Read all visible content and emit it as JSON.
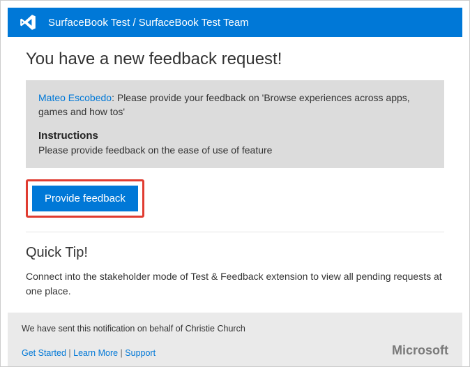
{
  "header": {
    "breadcrumb": "SurfaceBook Test / SurfaceBook Test Team"
  },
  "title": "You have a new feedback request!",
  "request": {
    "requester_name": "Mateo Escobedo",
    "message_separator": ": ",
    "message": "Please provide your feedback on 'Browse experiences across  apps, games and how tos'",
    "instructions_heading": "Instructions",
    "instructions_body": "Please provide feedback on the ease of use of feature"
  },
  "provide_button": "Provide feedback",
  "tip": {
    "title": "Quick Tip!",
    "body": "Connect into the stakeholder mode of Test & Feedback extension to view all pending requests at one place."
  },
  "footer": {
    "notification_text": "We have sent this notification on behalf of  Christie Church",
    "links": {
      "get_started": "Get Started",
      "learn_more": "Learn More",
      "support": "Support"
    },
    "brand": "Microsoft"
  }
}
